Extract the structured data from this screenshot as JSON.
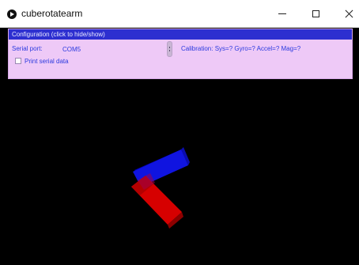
{
  "window": {
    "title": "cuberotatearm"
  },
  "config": {
    "header": "Configuration (click to hide/show)",
    "serial_port_label": "Serial port:",
    "serial_port_value": "COM5",
    "calibration": "Calibration: Sys=? Gyro=? Accel=? Mag=?",
    "print_serial_label": "Print serial data",
    "print_serial_checked": false
  },
  "scene": {
    "blue_box_color": "#1014e0",
    "red_box_color": "#d60000"
  },
  "icons": {
    "app": "processing-play-icon",
    "minimize": "minimize-icon",
    "maximize": "maximize-icon",
    "close": "close-icon",
    "dropdown": "dropdown-handle-icon"
  }
}
